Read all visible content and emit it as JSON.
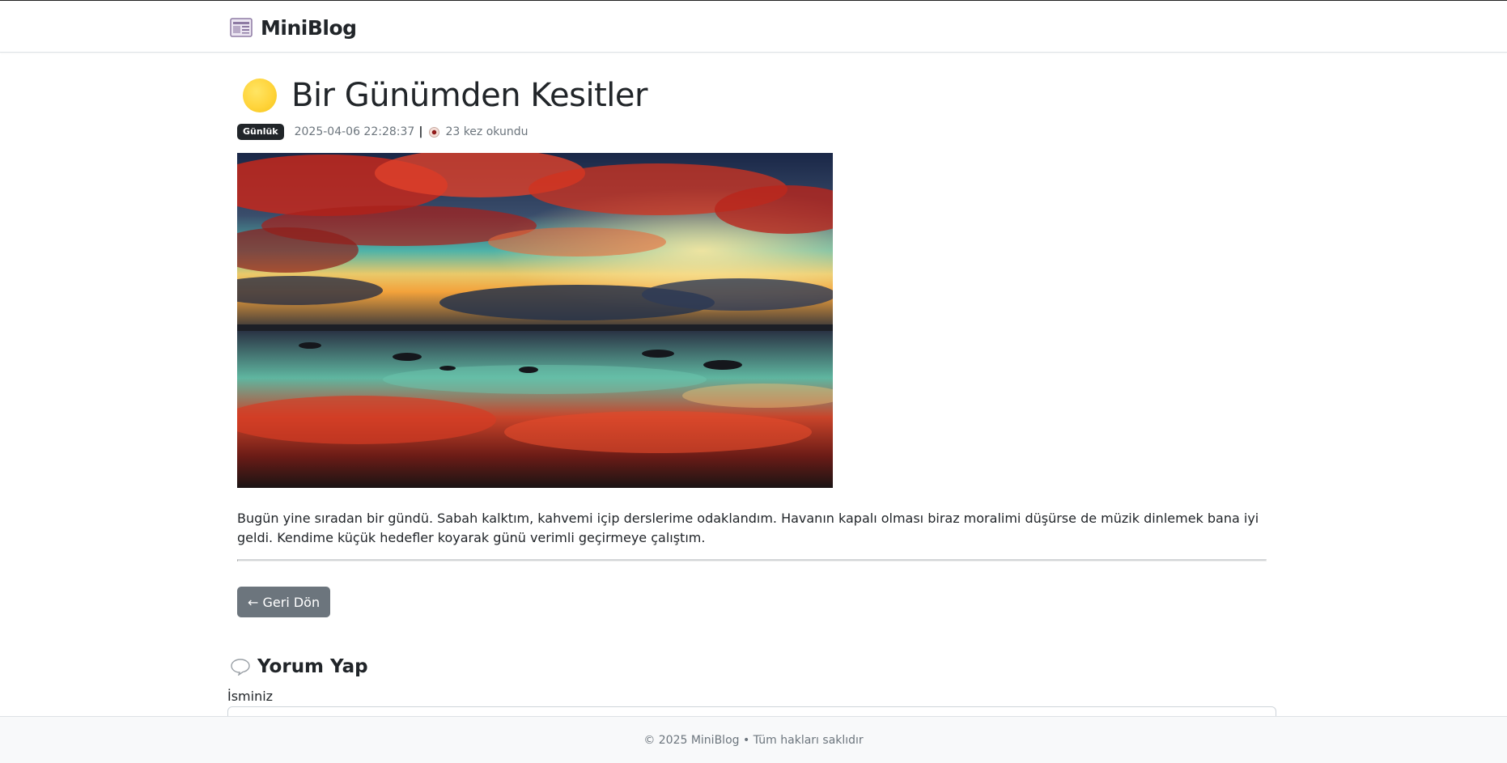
{
  "navbar": {
    "brand_icon": "newspaper-icon",
    "brand": "MiniBlog"
  },
  "post": {
    "title_icon": "yellow-circle-icon",
    "title": "Bir Günümden Kesitler",
    "category": "Günlük",
    "datetime": "2025-04-06 22:28:37",
    "separator": "|",
    "views_icon": "eye-icon",
    "views": "23 kez okundu",
    "image": "sunset-reflection-image",
    "body": "Bugün yine sıradan bir gündü. Sabah kalktım, kahvemi içip derslerime odaklandım. Havanın kapalı olması biraz moralimi düşürse de müzik dinlemek bana iyi geldi. Kendime küçük hedefler koyarak günü verimli geçirmeye çalıştım."
  },
  "actions": {
    "back_label": "← Geri Dön"
  },
  "comment_form": {
    "heading_icon": "speech-bubble-icon",
    "heading": "Yorum Yap",
    "name_label": "İsminiz",
    "name_value": ""
  },
  "footer": {
    "text": "© 2025 MiniBlog • Tüm hakları saklıdır"
  },
  "colors": {
    "badge_bg": "#212529",
    "button_bg": "#6c757d",
    "sun": "#ffd43b",
    "footer_bg": "#f8f9fa"
  }
}
